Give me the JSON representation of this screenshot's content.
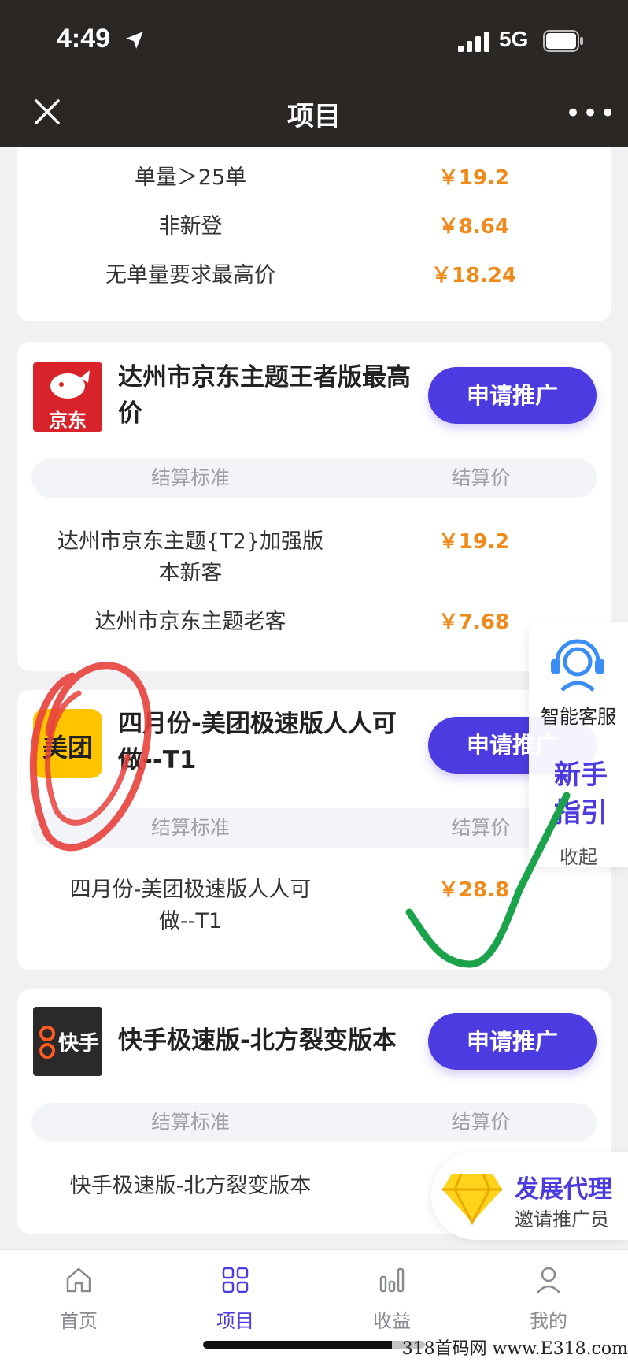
{
  "status_bar": {
    "time": "4:49",
    "network": "5G"
  },
  "nav": {
    "title": "项目",
    "more": "•••"
  },
  "top_card": {
    "rows": [
      {
        "standard": "单量＞25单",
        "price": "￥19.2"
      },
      {
        "standard": "非新登",
        "price": "￥8.64"
      },
      {
        "standard": "无单量要求最高价",
        "price": "￥18.24"
      }
    ]
  },
  "projects": [
    {
      "logo_text": "京东",
      "title": "达州市京东主题王者版最高价",
      "button": "申请推广",
      "head_std": "结算标准",
      "head_price": "结算价",
      "rows": [
        {
          "standard_line1": "达州市京东主题{T2}加强版",
          "standard_line2": "本新客",
          "price": "￥19.2"
        },
        {
          "standard_line1": "达州市京东主题老客",
          "standard_line2": "",
          "price": "￥7.68"
        }
      ]
    },
    {
      "logo_text": "美团",
      "title": "四月份-美团极速版人人可做--T1",
      "button": "申请推广",
      "head_std": "结算标准",
      "head_price": "结算价",
      "rows": [
        {
          "standard_line1": "四月份-美团极速版人人可",
          "standard_line2": "做--T1",
          "price": "￥28.8"
        }
      ]
    },
    {
      "logo_text": "快手",
      "title": "快手极速版-北方裂变版本",
      "button": "申请推广",
      "head_std": "结算标准",
      "head_price": "结算价",
      "rows": [
        {
          "standard_line1": "快手极速版-北方裂变版本",
          "standard_line2": "",
          "price": ""
        }
      ]
    }
  ],
  "floater": {
    "customer_service": "智能客服",
    "guide": "新手指引",
    "collapse": "收起"
  },
  "agent_promo": {
    "title": "发展代理",
    "subtitle": "邀请推广员"
  },
  "tabs": [
    {
      "label": "首页",
      "icon": "home-icon",
      "active": false
    },
    {
      "label": "项目",
      "icon": "grid-icon",
      "active": true
    },
    {
      "label": "收益",
      "icon": "bar-chart-icon",
      "active": false
    },
    {
      "label": "我的",
      "icon": "user-icon",
      "active": false
    }
  ],
  "watermark": "318首码网 www.E318.com",
  "colors": {
    "accent": "#4b3be0",
    "price": "#f08a1a",
    "header": "#2b2725",
    "jd_red": "#d8232a",
    "meituan_yellow": "#ffc300"
  }
}
